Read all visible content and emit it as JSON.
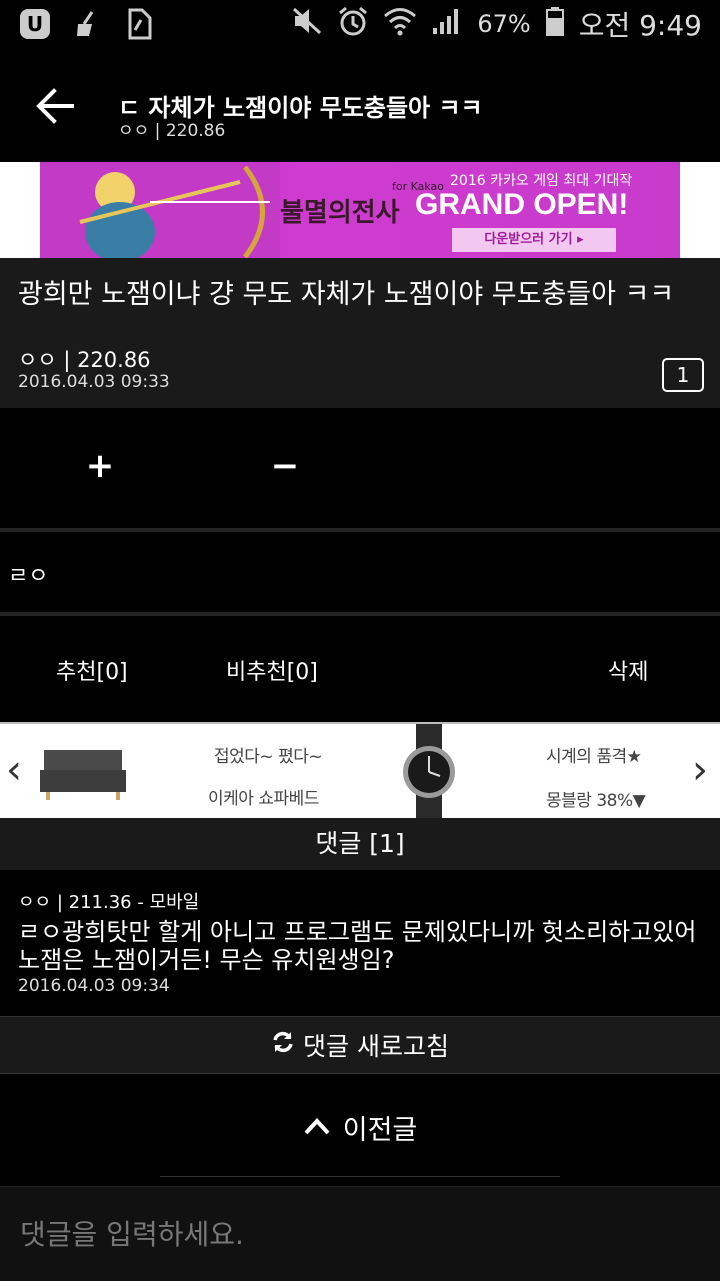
{
  "status_bar": {
    "battery": "67%",
    "time": "오전 9:49",
    "left_icons": [
      "u-plus-icon",
      "cleaner-icon",
      "sim-icon"
    ],
    "right_icons": [
      "mute-icon",
      "alarm-icon",
      "wifi-icon",
      "signal-icon",
      "battery-icon"
    ]
  },
  "header": {
    "title": "ㄷ 자체가 노잼이야 무도충들아 ㅋㅋ",
    "subtitle": "ㅇㅇ | 220.86"
  },
  "banner": {
    "game_title": "불멸의전사",
    "game_sub": "for Kakao",
    "tagline": "2016 카카오 게임 최대 기대작",
    "headline": "GRAND OPEN!",
    "cta": "다운받으러 가기 ▸"
  },
  "post": {
    "title": "광희만 노잼이냐 걍 무도 자체가 노잼이야 무도충들아 ㅋㅋ",
    "author": "ㅇㅇ | 220.86",
    "date": "2016.04.03 09:33",
    "comment_count": "1"
  },
  "vote": {
    "plus": "+",
    "minus": "−"
  },
  "body": {
    "text": "ㄹㅇ"
  },
  "actions": {
    "recommend": "추천[0]",
    "not_recommend": "비추천[0]",
    "delete": "삭제"
  },
  "ad": {
    "item1_line1": "접었다~ 폈다~",
    "item1_line2": "이케아 쇼파베드",
    "item2_line1": "시계의 품격★",
    "item2_line2": "몽블랑 38%▼",
    "left_arrow": "‹",
    "right_arrow": "›"
  },
  "comments": {
    "header": "댓글 [1]",
    "items": [
      {
        "author": "ㅇㅇ | 211.36 - 모바일",
        "text": "ㄹㅇ광희탓만 할게 아니고 프로그램도 문제있다니까 헛소리하고있어 노잼은 노잼이거든! 무슨 유치원생임?",
        "date": "2016.04.03 09:34"
      }
    ],
    "refresh": "댓글 새로고침"
  },
  "nav": {
    "prev": "이전글"
  },
  "input": {
    "placeholder": "댓글을 입력하세요."
  },
  "colors": {
    "background": "#000000",
    "panel": "#1a1a1a",
    "banner": "#c73bcb"
  }
}
